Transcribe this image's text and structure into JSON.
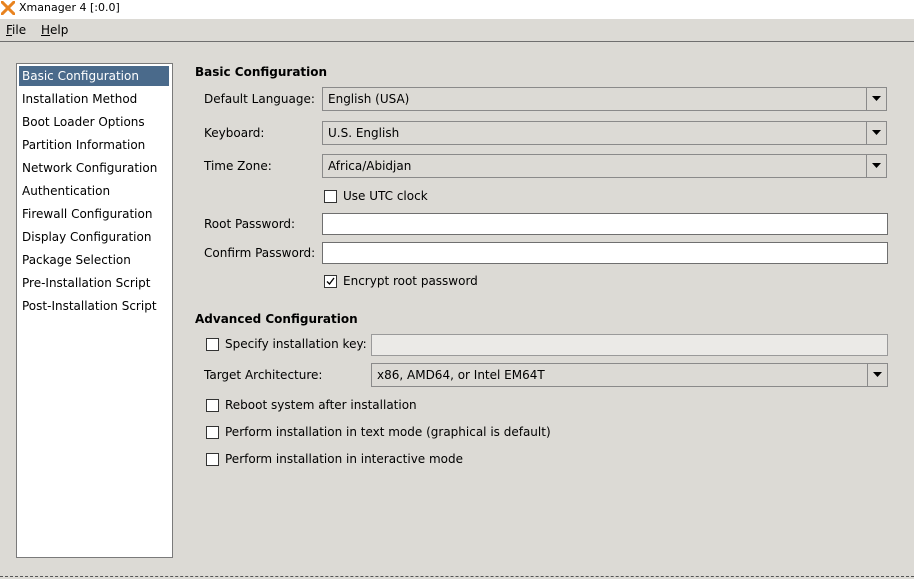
{
  "window": {
    "title": "Xmanager 4 [:0.0]"
  },
  "menu": {
    "file_rest": "ile",
    "file_mnemonic": "F",
    "help_rest": "elp",
    "help_mnemonic": "H"
  },
  "sidebar": {
    "items": [
      {
        "label": "Basic Configuration"
      },
      {
        "label": "Installation Method"
      },
      {
        "label": "Boot Loader Options"
      },
      {
        "label": "Partition Information"
      },
      {
        "label": "Network Configuration"
      },
      {
        "label": "Authentication"
      },
      {
        "label": "Firewall Configuration"
      },
      {
        "label": "Display Configuration"
      },
      {
        "label": "Package Selection"
      },
      {
        "label": "Pre-Installation Script"
      },
      {
        "label": "Post-Installation Script"
      }
    ],
    "selected_index": 0
  },
  "basic": {
    "title": "Basic Configuration",
    "language_label": "Default Language:",
    "language_value": "English (USA)",
    "keyboard_label": "Keyboard:",
    "keyboard_value": "U.S. English",
    "timezone_label": "Time Zone:",
    "timezone_value": "Africa/Abidjan",
    "utc_label": "Use UTC clock",
    "utc_checked": false,
    "root_password_label": "Root Password:",
    "root_password_value": "",
    "confirm_password_label": "Confirm Password:",
    "confirm_password_value": "",
    "encrypt_label": "Encrypt root password",
    "encrypt_checked": true
  },
  "advanced": {
    "title": "Advanced Configuration",
    "install_key_label": "Specify installation key:",
    "install_key_checked": false,
    "install_key_value": "",
    "arch_label": "Target Architecture:",
    "arch_value": "x86, AMD64, or Intel EM64T",
    "reboot_label": "Reboot system after installation",
    "reboot_checked": false,
    "textmode_label": "Perform installation in text mode (graphical is default)",
    "textmode_checked": false,
    "interactive_label": "Perform installation in interactive mode",
    "interactive_checked": false
  },
  "colors": {
    "background": "#dcdad5",
    "selection": "#4a6a8b",
    "logo_orange": "#e8831f"
  },
  "icons": [
    "xmanager-logo-icon",
    "dropdown-arrow-icon",
    "checkmark-icon"
  ]
}
